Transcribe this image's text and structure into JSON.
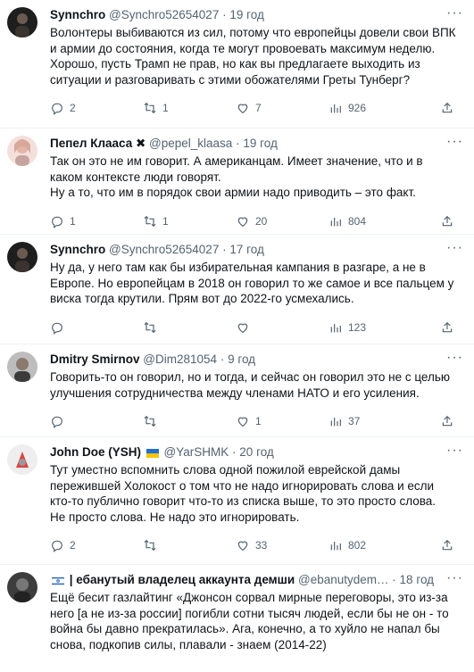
{
  "tweets": [
    {
      "name": "Synnchro",
      "handle": "@Synchro52654027",
      "time": "19 год",
      "lines": [
        "Волонтеры выбиваются из сил, потому что европейцы довели свои ВПК",
        "и армии до состояния, когда те могут провоевать максимум неделю.",
        "Хорошо, пусть Трамп не прав, но как вы предлагаете выходить из",
        "ситуации и разговаривать с этими обожателями Греты Тунберг?"
      ],
      "replies": "2",
      "retweets": "1",
      "likes": "7",
      "views": "926",
      "avatar_color": "#2a2a2a"
    },
    {
      "name": "Пепел Клааса ✖",
      "handle": "@pepel_klaasa",
      "time": "19 год",
      "lines": [
        "Так он это не им говорит. А американцам. Имеет значение, что и в",
        "каком контексте люди говорят.",
        "Ну а то, что им в порядок свои армии надо приводить – это факт."
      ],
      "replies": "1",
      "retweets": "1",
      "likes": "20",
      "views": "804",
      "avatar_color": "#e9c9c4"
    },
    {
      "name": "Synnchro",
      "handle": "@Synchro52654027",
      "time": "17 год",
      "lines": [
        "Ну да, у него там как бы избирательная кампания в разгаре, а не в",
        "Европе. Но европейцам в 2018 он говорил то же самое и все пальцем у",
        "виска тогда крутили. Прям вот до 2022-го усмехались."
      ],
      "replies": "",
      "retweets": "",
      "likes": "",
      "views": "123",
      "avatar_color": "#2a2a2a"
    },
    {
      "name": "Dmitry Smirnov",
      "handle": "@Dim281054",
      "time": "9 год",
      "lines": [
        "Говорить-то он говорил, но и тогда, и сейчас он говорил это не с целью",
        "улучшения сотрудничества между членами НАТО и его усиления."
      ],
      "replies": "",
      "retweets": "",
      "likes": "1",
      "views": "37",
      "avatar_color": "#6b6b6b"
    },
    {
      "name": "John Doe (YSH)",
      "handle": "@YarSHMK",
      "time": "20 год",
      "lines": [
        "Тут уместно вспомнить слова одной пожилой еврейской дамы",
        "пережившей Холокост о том что не надо игнорировать слова и если",
        "кто-то публично говорит что-то из списка выше, то это просто слова.",
        "Не просто слова. Не надо это игнорировать."
      ],
      "replies": "2",
      "retweets": "",
      "likes": "33",
      "views": "802",
      "avatar_color": "#d9d9d9"
    },
    {
      "name": "| ебанутый владелец аккаунта демши",
      "handle": "@ebanutydem…",
      "time": "18 год",
      "lines": [
        "Ещё бесит газлайтинг «Джонсон сорвал мирные переговоры, это из-за",
        "него [а не из-за россии] погибли сотни тысяч людей, если бы не он - то",
        "война бы давно прекратилась». Ага, конечно, а то хуйло не напал бы",
        "снова, подкопив силы, плавали - знаем (2014-22)"
      ],
      "replies": "",
      "retweets": "",
      "likes": "",
      "views": "",
      "avatar_color": "#4a4a4a"
    }
  ]
}
